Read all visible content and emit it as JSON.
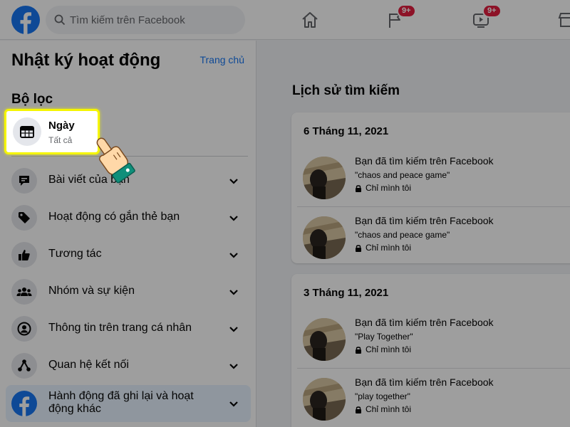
{
  "topbar": {
    "search_placeholder": "Tìm kiếm trên Facebook",
    "flag_badge": "9+",
    "watch_badge": "9+"
  },
  "left": {
    "title": "Nhật ký hoạt động",
    "home_link": "Trang chủ",
    "filter_title": "Bộ lọc",
    "filter": {
      "label": "Ngày",
      "sub": "Tất cả"
    },
    "items": [
      {
        "label": "Bài viết của bạn",
        "icon": "post-icon"
      },
      {
        "label": "Hoạt động có gắn thẻ bạn",
        "icon": "tag-icon"
      },
      {
        "label": "Tương tác",
        "icon": "like-icon"
      },
      {
        "label": "Nhóm và sự kiện",
        "icon": "groups-icon"
      },
      {
        "label": "Thông tin trên trang cá nhân",
        "icon": "profile-icon"
      },
      {
        "label": "Quan hệ kết nối",
        "icon": "connections-icon"
      },
      {
        "label": "Hành động đã ghi lại và hoạt động khác",
        "icon": "facebook-icon"
      }
    ]
  },
  "content": {
    "section_title": "Lịch sử tìm kiếm",
    "groups": [
      {
        "date": "6 Tháng 11, 2021",
        "entries": [
          {
            "title": "Bạn đã tìm kiếm trên Facebook",
            "query": "\"chaos and peace game\"",
            "privacy": "Chỉ mình tôi"
          },
          {
            "title": "Bạn đã tìm kiếm trên Facebook",
            "query": "\"chaos and peace game\"",
            "privacy": "Chỉ mình tôi"
          }
        ]
      },
      {
        "date": "3 Tháng 11, 2021",
        "entries": [
          {
            "title": "Bạn đã tìm kiếm trên Facebook",
            "query": "\"Play Together\"",
            "privacy": "Chỉ mình tôi"
          },
          {
            "title": "Bạn đã tìm kiếm trên Facebook",
            "query": "\"play together\"",
            "privacy": "Chỉ mình tôi"
          }
        ]
      }
    ]
  },
  "colors": {
    "brand": "#1877f2",
    "highlight": "#f5f500",
    "badge": "#e41e3f"
  }
}
